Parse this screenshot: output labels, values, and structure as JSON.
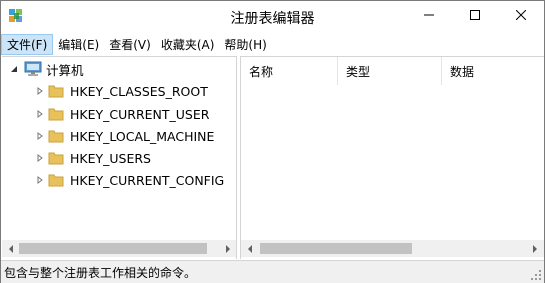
{
  "window": {
    "title": "注册表编辑器"
  },
  "menu": [
    {
      "label": "文件(F)"
    },
    {
      "label": "编辑(E)"
    },
    {
      "label": "查看(V)"
    },
    {
      "label": "收藏夹(A)"
    },
    {
      "label": "帮助(H)"
    }
  ],
  "tree": {
    "root_label": "计算机",
    "keys": [
      {
        "label": "HKEY_CLASSES_ROOT"
      },
      {
        "label": "HKEY_CURRENT_USER"
      },
      {
        "label": "HKEY_LOCAL_MACHINE"
      },
      {
        "label": "HKEY_USERS"
      },
      {
        "label": "HKEY_CURRENT_CONFIG"
      }
    ]
  },
  "list": {
    "columns": [
      {
        "label": "名称"
      },
      {
        "label": "类型"
      },
      {
        "label": "数据"
      }
    ]
  },
  "status": {
    "text": "包含与整个注册表工作相关的命令。"
  },
  "colors": {
    "menu_active_bg": "#cce4f7",
    "folder": "#e8c15a",
    "scroll_track": "#f0f0f0",
    "scroll_thumb": "#c2c2c2"
  },
  "icons": [
    "regedit-icon",
    "minimize-icon",
    "maximize-icon",
    "close-icon",
    "computer-icon",
    "folder-icon",
    "expand-arrow-icon",
    "scroll-left-icon",
    "scroll-right-icon",
    "size-grip-icon"
  ]
}
